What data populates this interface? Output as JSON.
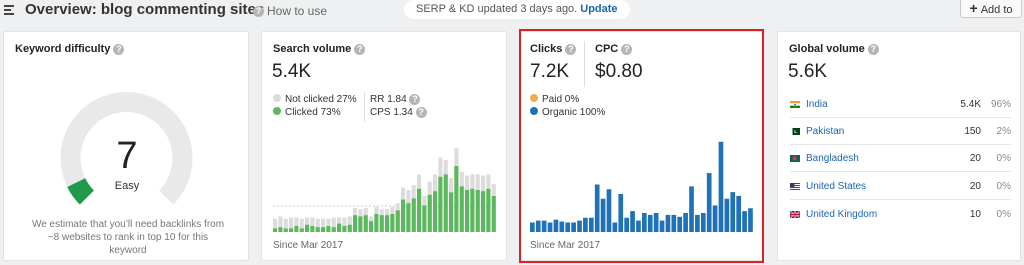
{
  "header": {
    "title": "Overview: blog commenting sites",
    "help_label": "How to use",
    "notice_text": "SERP & KD updated 3 days ago.",
    "notice_link": "Update",
    "add_to_label": "Add to"
  },
  "kd": {
    "title": "Keyword difficulty",
    "score": "7",
    "score_label": "Easy",
    "score_fraction": 0.07,
    "note": "We estimate that you’ll need backlinks from ~8 websites to rank in top 10 for this keyword"
  },
  "search_volume": {
    "title": "Search volume",
    "value": "5.4K",
    "not_clicked": "Not clicked 27%",
    "clicked": "Clicked 73%",
    "rr": "RR 1.84",
    "cps": "CPS 1.34",
    "since": "Since Mar 2017",
    "chart_total": [
      11,
      13,
      11,
      12,
      12,
      11,
      12,
      12,
      11,
      11,
      11,
      12,
      12,
      12,
      13,
      20,
      19,
      20,
      13,
      21,
      19,
      19,
      21,
      24,
      37,
      35,
      39,
      48,
      30,
      42,
      48,
      62,
      60,
      45,
      70,
      50,
      47,
      48,
      48,
      47,
      48,
      40
    ],
    "chart_clicked": [
      3,
      4,
      3,
      3,
      5,
      3,
      6,
      5,
      4,
      4,
      5,
      4,
      7,
      5,
      6,
      14,
      13,
      14,
      9,
      15,
      14,
      14,
      15,
      18,
      27,
      24,
      28,
      36,
      22,
      31,
      34,
      46,
      48,
      33,
      55,
      38,
      35,
      36,
      35,
      34,
      36,
      30
    ]
  },
  "clicks": {
    "clicks_title": "Clicks",
    "clicks_value": "7.2K",
    "cpc_title": "CPC",
    "cpc_value": "$0.80",
    "paid": "Paid 0%",
    "organic": "Organic 100%",
    "since": "Since Mar 2017",
    "chart_values": [
      10,
      12,
      12,
      10,
      13,
      11,
      10,
      10,
      12,
      15,
      15,
      50,
      35,
      45,
      10,
      40,
      15,
      22,
      12,
      20,
      18,
      20,
      12,
      18,
      18,
      16,
      20,
      48,
      18,
      20,
      62,
      28,
      95,
      35,
      42,
      38,
      22,
      25
    ]
  },
  "global_volume": {
    "title": "Global volume",
    "value": "5.6K",
    "countries": [
      {
        "name": "India",
        "volume": "5.4K",
        "pct": "96%",
        "flag": "in"
      },
      {
        "name": "Pakistan",
        "volume": "150",
        "pct": "2%",
        "flag": "pk"
      },
      {
        "name": "Bangladesh",
        "volume": "20",
        "pct": "0%",
        "flag": "bd"
      },
      {
        "name": "United States",
        "volume": "20",
        "pct": "0%",
        "flag": "us"
      },
      {
        "name": "United Kingdom",
        "volume": "10",
        "pct": "0%",
        "flag": "gb"
      }
    ]
  },
  "colors": {
    "green": "#5cb85c",
    "grey_bar": "#dcdcdc",
    "blue": "#1f72b8",
    "orange": "#f0ad4e",
    "kd_green": "#1e9a4b",
    "highlight": "#e02020"
  }
}
